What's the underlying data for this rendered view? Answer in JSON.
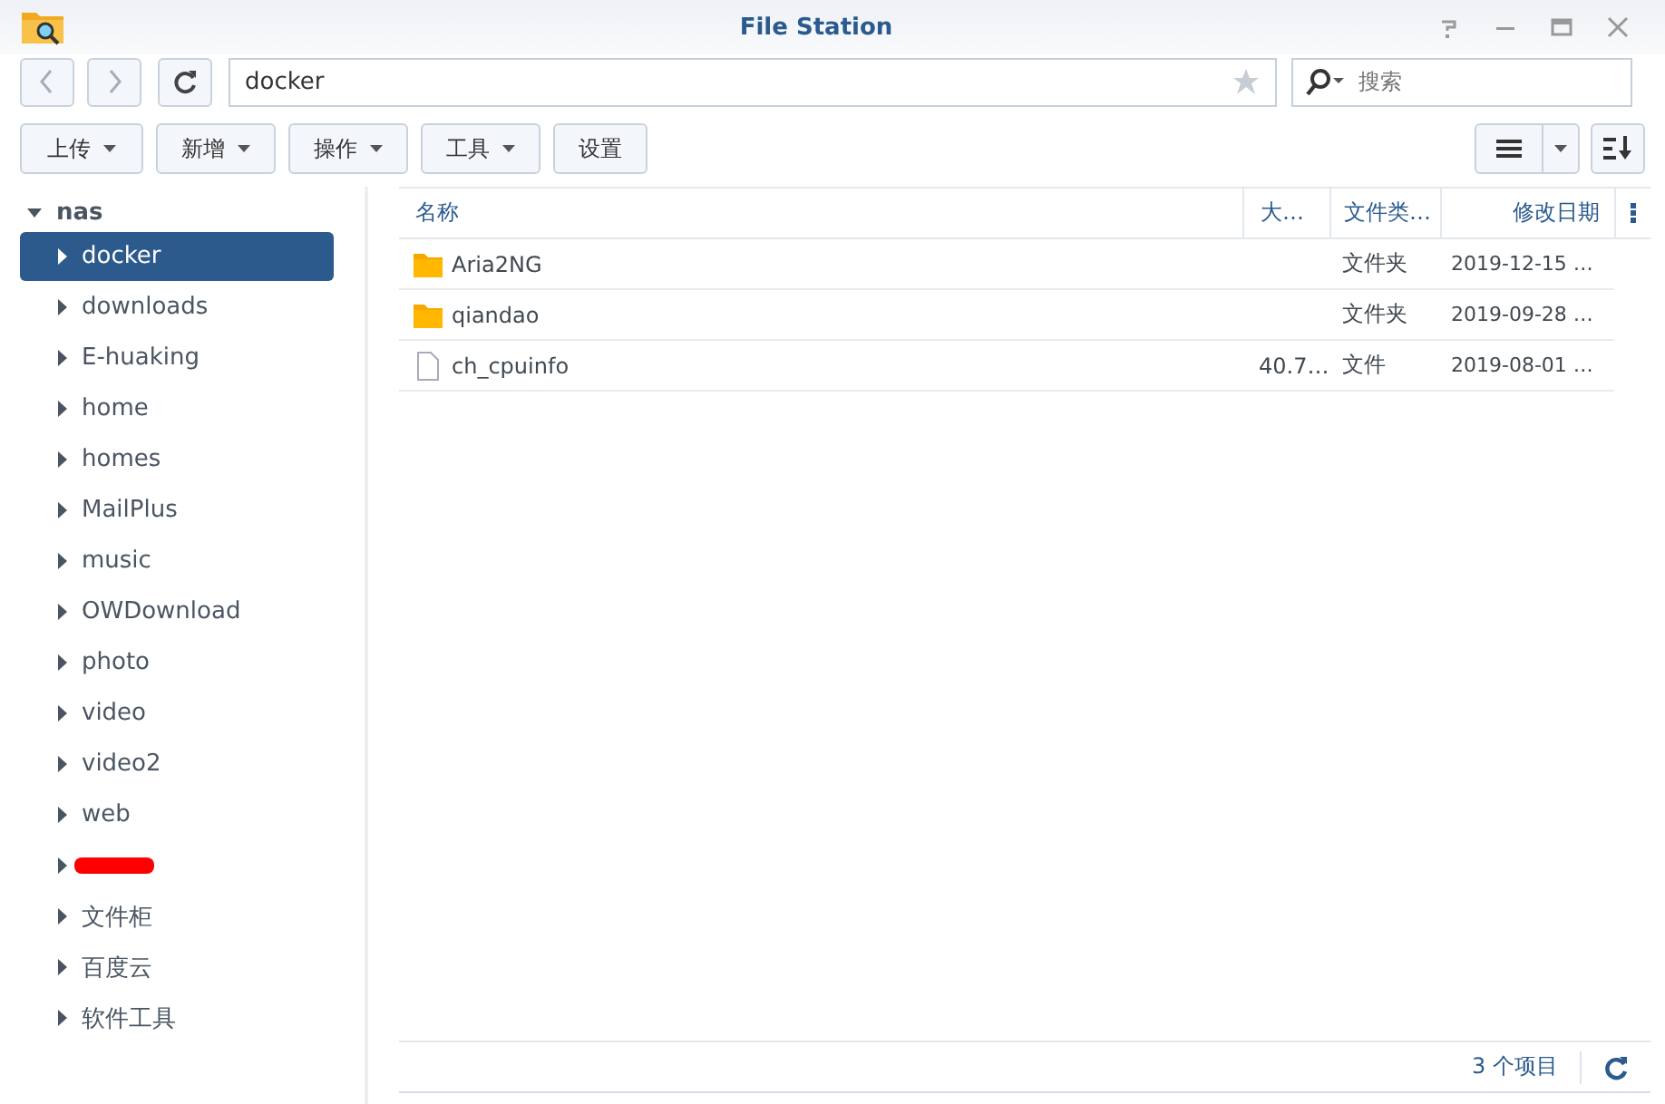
{
  "window": {
    "title": "File Station"
  },
  "path_field": {
    "value": "docker"
  },
  "search": {
    "placeholder": "搜索"
  },
  "toolbar": [
    {
      "label": "上传",
      "dropdown": true
    },
    {
      "label": "新增",
      "dropdown": true
    },
    {
      "label": "操作",
      "dropdown": true
    },
    {
      "label": "工具",
      "dropdown": true
    },
    {
      "label": "设置",
      "dropdown": false
    }
  ],
  "sidebar": {
    "root": {
      "label": "nas",
      "expanded": true,
      "children": [
        {
          "label": "docker",
          "selected": true
        },
        {
          "label": "downloads",
          "selected": false
        },
        {
          "label": "E-huaking",
          "selected": false
        },
        {
          "label": "home",
          "selected": false
        },
        {
          "label": "homes",
          "selected": false
        },
        {
          "label": "MailPlus",
          "selected": false
        },
        {
          "label": "music",
          "selected": false
        },
        {
          "label": "OWDownload",
          "selected": false
        },
        {
          "label": "photo",
          "selected": false
        },
        {
          "label": "video",
          "selected": false
        },
        {
          "label": "video2",
          "selected": false
        },
        {
          "label": "web",
          "selected": false
        },
        {
          "kind": "redacted",
          "selected": false
        },
        {
          "label": "文件柜",
          "selected": false
        },
        {
          "label": "百度云",
          "selected": false
        },
        {
          "label": "软件工具",
          "selected": false
        }
      ]
    }
  },
  "table": {
    "columns": [
      "名称",
      "大…",
      "文件类…",
      "修改日期"
    ],
    "rows": [
      {
        "kind": "folder",
        "name": "Aria2NG",
        "size": "",
        "type": "文件夹",
        "modified": "2019-12-15 …"
      },
      {
        "kind": "folder",
        "name": "qiandao",
        "size": "",
        "type": "文件夹",
        "modified": "2019-09-28 …"
      },
      {
        "kind": "file",
        "name": "ch_cpuinfo",
        "size": "40.7…",
        "type": "文件",
        "modified": "2019-08-01 …"
      }
    ]
  },
  "status_bar": {
    "count": "3 个项目"
  }
}
